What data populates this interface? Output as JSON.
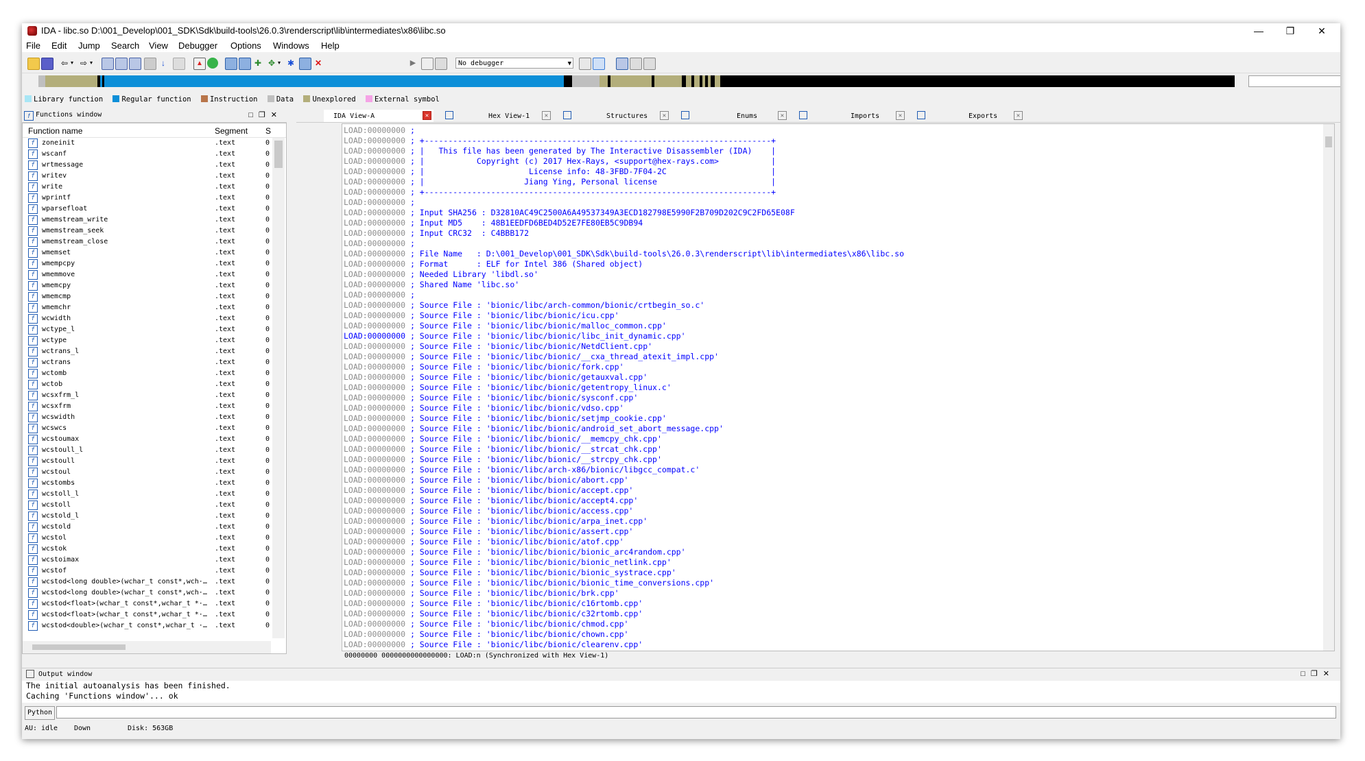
{
  "window": {
    "title": "IDA - libc.so D:\\001_Develop\\001_SDK\\Sdk\\build-tools\\26.0.3\\renderscript\\lib\\intermediates\\x86\\libc.so",
    "controls": [
      "—",
      "❐",
      "✕"
    ]
  },
  "menu": [
    "File",
    "Edit",
    "Jump",
    "Search",
    "View",
    "Debugger",
    "Options",
    "Windows",
    "Help"
  ],
  "toolbar": {
    "debugger_select": "No debugger"
  },
  "legend": [
    {
      "label": "Library function",
      "color": "#a8e6f5"
    },
    {
      "label": "Regular function",
      "color": "#0c8fd8"
    },
    {
      "label": "Instruction",
      "color": "#b8754a"
    },
    {
      "label": "Data",
      "color": "#bfbfbf"
    },
    {
      "label": "Unexplored",
      "color": "#b3ae7b"
    },
    {
      "label": "External symbol",
      "color": "#f5a3e6"
    }
  ],
  "functions_window": {
    "title": "Functions window",
    "columns": [
      "Function name",
      "Segment",
      "S"
    ],
    "rows": [
      {
        "name": "zoneinit",
        "segment": ".text",
        "start": "0"
      },
      {
        "name": "wscanf",
        "segment": ".text",
        "start": "0"
      },
      {
        "name": "wrtmessage",
        "segment": ".text",
        "start": "0"
      },
      {
        "name": "writev",
        "segment": ".text",
        "start": "0"
      },
      {
        "name": "write",
        "segment": ".text",
        "start": "0"
      },
      {
        "name": "wprintf",
        "segment": ".text",
        "start": "0"
      },
      {
        "name": "wparsefloat",
        "segment": ".text",
        "start": "0"
      },
      {
        "name": "wmemstream_write",
        "segment": ".text",
        "start": "0"
      },
      {
        "name": "wmemstream_seek",
        "segment": ".text",
        "start": "0"
      },
      {
        "name": "wmemstream_close",
        "segment": ".text",
        "start": "0"
      },
      {
        "name": "wmemset",
        "segment": ".text",
        "start": "0"
      },
      {
        "name": "wmempcpy",
        "segment": ".text",
        "start": "0"
      },
      {
        "name": "wmemmove",
        "segment": ".text",
        "start": "0"
      },
      {
        "name": "wmemcpy",
        "segment": ".text",
        "start": "0"
      },
      {
        "name": "wmemcmp",
        "segment": ".text",
        "start": "0"
      },
      {
        "name": "wmemchr",
        "segment": ".text",
        "start": "0"
      },
      {
        "name": "wcwidth",
        "segment": ".text",
        "start": "0"
      },
      {
        "name": "wctype_l",
        "segment": ".text",
        "start": "0"
      },
      {
        "name": "wctype",
        "segment": ".text",
        "start": "0"
      },
      {
        "name": "wctrans_l",
        "segment": ".text",
        "start": "0"
      },
      {
        "name": "wctrans",
        "segment": ".text",
        "start": "0"
      },
      {
        "name": "wctomb",
        "segment": ".text",
        "start": "0"
      },
      {
        "name": "wctob",
        "segment": ".text",
        "start": "0"
      },
      {
        "name": "wcsxfrm_l",
        "segment": ".text",
        "start": "0"
      },
      {
        "name": "wcsxfrm",
        "segment": ".text",
        "start": "0"
      },
      {
        "name": "wcswidth",
        "segment": ".text",
        "start": "0"
      },
      {
        "name": "wcswcs",
        "segment": ".text",
        "start": "0"
      },
      {
        "name": "wcstoumax",
        "segment": ".text",
        "start": "0"
      },
      {
        "name": "wcstoull_l",
        "segment": ".text",
        "start": "0"
      },
      {
        "name": "wcstoull",
        "segment": ".text",
        "start": "0"
      },
      {
        "name": "wcstoul",
        "segment": ".text",
        "start": "0"
      },
      {
        "name": "wcstombs",
        "segment": ".text",
        "start": "0"
      },
      {
        "name": "wcstoll_l",
        "segment": ".text",
        "start": "0"
      },
      {
        "name": "wcstoll",
        "segment": ".text",
        "start": "0"
      },
      {
        "name": "wcstold_l",
        "segment": ".text",
        "start": "0"
      },
      {
        "name": "wcstold",
        "segment": ".text",
        "start": "0"
      },
      {
        "name": "wcstol",
        "segment": ".text",
        "start": "0"
      },
      {
        "name": "wcstok",
        "segment": ".text",
        "start": "0"
      },
      {
        "name": "wcstoimax",
        "segment": ".text",
        "start": "0"
      },
      {
        "name": "wcstof",
        "segment": ".text",
        "start": "0"
      },
      {
        "name": "wcstod<long double>(wchar_t const*,wch···",
        "segment": ".text",
        "start": "0"
      },
      {
        "name": "wcstod<long double>(wchar_t const*,wch···",
        "segment": ".text",
        "start": "0"
      },
      {
        "name": "wcstod<float>(wchar_t const*,wchar_t *···",
        "segment": ".text",
        "start": "0"
      },
      {
        "name": "wcstod<float>(wchar_t const*,wchar_t *···",
        "segment": ".text",
        "start": "0"
      },
      {
        "name": "wcstod<double>(wchar_t const*,wchar_t ···",
        "segment": ".text",
        "start": "0"
      }
    ]
  },
  "tabs": [
    {
      "label": "IDA View-A",
      "active": true
    },
    {
      "label": "Hex View-1",
      "active": false
    },
    {
      "label": "Structures",
      "active": false
    },
    {
      "label": "Enums",
      "active": false
    },
    {
      "label": "Imports",
      "active": false
    },
    {
      "label": "Exports",
      "active": false
    }
  ],
  "disassembly": {
    "lines": [
      {
        "addr": "LOAD:00000000",
        "text": " ;"
      },
      {
        "addr": "LOAD:00000000",
        "text": " ; +-------------------------------------------------------------------------+"
      },
      {
        "addr": "LOAD:00000000",
        "text": " ; |   This file has been generated by The Interactive Disassembler (IDA)    |"
      },
      {
        "addr": "LOAD:00000000",
        "text": " ; |           Copyright (c) 2017 Hex-Rays, <support@hex-rays.com>           |"
      },
      {
        "addr": "LOAD:00000000",
        "text": " ; |                      License info: 48-3FBD-7F04-2C                      |"
      },
      {
        "addr": "LOAD:00000000",
        "text": " ; |                     Jiang Ying, Personal license                        |"
      },
      {
        "addr": "LOAD:00000000",
        "text": " ; +-------------------------------------------------------------------------+"
      },
      {
        "addr": "LOAD:00000000",
        "text": " ;"
      },
      {
        "addr": "LOAD:00000000",
        "text": " ; Input SHA256 : D32810AC49C2500A6A49537349A3ECD182798E5990F2B709D202C9C2FD65E08F"
      },
      {
        "addr": "LOAD:00000000",
        "text": " ; Input MD5    : 48B1EEDFD6BED4D52E7FE80EB5C9DB94"
      },
      {
        "addr": "LOAD:00000000",
        "text": " ; Input CRC32  : C4BBB172"
      },
      {
        "addr": "LOAD:00000000",
        "text": " ;"
      },
      {
        "addr": "LOAD:00000000",
        "text": " ; File Name   : D:\\001_Develop\\001_SDK\\Sdk\\build-tools\\26.0.3\\renderscript\\lib\\intermediates\\x86\\libc.so"
      },
      {
        "addr": "LOAD:00000000",
        "text": " ; Format      : ELF for Intel 386 (Shared object)"
      },
      {
        "addr": "LOAD:00000000",
        "text": " ; Needed Library 'libdl.so'"
      },
      {
        "addr": "LOAD:00000000",
        "text": " ; Shared Name 'libc.so'"
      },
      {
        "addr": "LOAD:00000000",
        "text": " ;"
      },
      {
        "addr": "LOAD:00000000",
        "text": " ; Source File : 'bionic/libc/arch-common/bionic/crtbegin_so.c'"
      },
      {
        "addr": "LOAD:00000000",
        "text": " ; Source File : 'bionic/libc/bionic/icu.cpp'"
      },
      {
        "addr": "LOAD:00000000",
        "text": " ; Source File : 'bionic/libc/bionic/malloc_common.cpp'"
      },
      {
        "addr": "LOAD:00000000",
        "text": " ; Source File : 'bionic/libc/bionic/libc_init_dynamic.cpp'",
        "hl": true
      },
      {
        "addr": "LOAD:00000000",
        "text": " ; Source File : 'bionic/libc/bionic/NetdClient.cpp'"
      },
      {
        "addr": "LOAD:00000000",
        "text": " ; Source File : 'bionic/libc/bionic/__cxa_thread_atexit_impl.cpp'"
      },
      {
        "addr": "LOAD:00000000",
        "text": " ; Source File : 'bionic/libc/bionic/fork.cpp'"
      },
      {
        "addr": "LOAD:00000000",
        "text": " ; Source File : 'bionic/libc/bionic/getauxval.cpp'"
      },
      {
        "addr": "LOAD:00000000",
        "text": " ; Source File : 'bionic/libc/bionic/getentropy_linux.c'"
      },
      {
        "addr": "LOAD:00000000",
        "text": " ; Source File : 'bionic/libc/bionic/sysconf.cpp'"
      },
      {
        "addr": "LOAD:00000000",
        "text": " ; Source File : 'bionic/libc/bionic/vdso.cpp'"
      },
      {
        "addr": "LOAD:00000000",
        "text": " ; Source File : 'bionic/libc/bionic/setjmp_cookie.cpp'"
      },
      {
        "addr": "LOAD:00000000",
        "text": " ; Source File : 'bionic/libc/bionic/android_set_abort_message.cpp'"
      },
      {
        "addr": "LOAD:00000000",
        "text": " ; Source File : 'bionic/libc/bionic/__memcpy_chk.cpp'"
      },
      {
        "addr": "LOAD:00000000",
        "text": " ; Source File : 'bionic/libc/bionic/__strcat_chk.cpp'"
      },
      {
        "addr": "LOAD:00000000",
        "text": " ; Source File : 'bionic/libc/bionic/__strcpy_chk.cpp'"
      },
      {
        "addr": "LOAD:00000000",
        "text": " ; Source File : 'bionic/libc/arch-x86/bionic/libgcc_compat.c'"
      },
      {
        "addr": "LOAD:00000000",
        "text": " ; Source File : 'bionic/libc/bionic/abort.cpp'"
      },
      {
        "addr": "LOAD:00000000",
        "text": " ; Source File : 'bionic/libc/bionic/accept.cpp'"
      },
      {
        "addr": "LOAD:00000000",
        "text": " ; Source File : 'bionic/libc/bionic/accept4.cpp'"
      },
      {
        "addr": "LOAD:00000000",
        "text": " ; Source File : 'bionic/libc/bionic/access.cpp'"
      },
      {
        "addr": "LOAD:00000000",
        "text": " ; Source File : 'bionic/libc/bionic/arpa_inet.cpp'"
      },
      {
        "addr": "LOAD:00000000",
        "text": " ; Source File : 'bionic/libc/bionic/assert.cpp'"
      },
      {
        "addr": "LOAD:00000000",
        "text": " ; Source File : 'bionic/libc/bionic/atof.cpp'"
      },
      {
        "addr": "LOAD:00000000",
        "text": " ; Source File : 'bionic/libc/bionic/bionic_arc4random.cpp'"
      },
      {
        "addr": "LOAD:00000000",
        "text": " ; Source File : 'bionic/libc/bionic/bionic_netlink.cpp'"
      },
      {
        "addr": "LOAD:00000000",
        "text": " ; Source File : 'bionic/libc/bionic/bionic_systrace.cpp'"
      },
      {
        "addr": "LOAD:00000000",
        "text": " ; Source File : 'bionic/libc/bionic/bionic_time_conversions.cpp'"
      },
      {
        "addr": "LOAD:00000000",
        "text": " ; Source File : 'bionic/libc/bionic/brk.cpp'"
      },
      {
        "addr": "LOAD:00000000",
        "text": " ; Source File : 'bionic/libc/bionic/c16rtomb.cpp'"
      },
      {
        "addr": "LOAD:00000000",
        "text": " ; Source File : 'bionic/libc/bionic/c32rtomb.cpp'"
      },
      {
        "addr": "LOAD:00000000",
        "text": " ; Source File : 'bionic/libc/bionic/chmod.cpp'"
      },
      {
        "addr": "LOAD:00000000",
        "text": " ; Source File : 'bionic/libc/bionic/chown.cpp'"
      },
      {
        "addr": "LOAD:00000000",
        "text": " ; Source File : 'bionic/libc/bionic/clearenv.cpp'"
      }
    ],
    "status": "00000000 0000000000000000: LOAD:n (Synchronized with Hex View-1)"
  },
  "output_window": {
    "title": "Output window",
    "lines": [
      "The initial autoanalysis has been finished.",
      "Caching 'Functions window'... ok"
    ]
  },
  "python_button": "Python",
  "statusbar": {
    "au": "AU:",
    "state": "idle",
    "dir": "Down",
    "disk": "Disk: 563GB"
  }
}
